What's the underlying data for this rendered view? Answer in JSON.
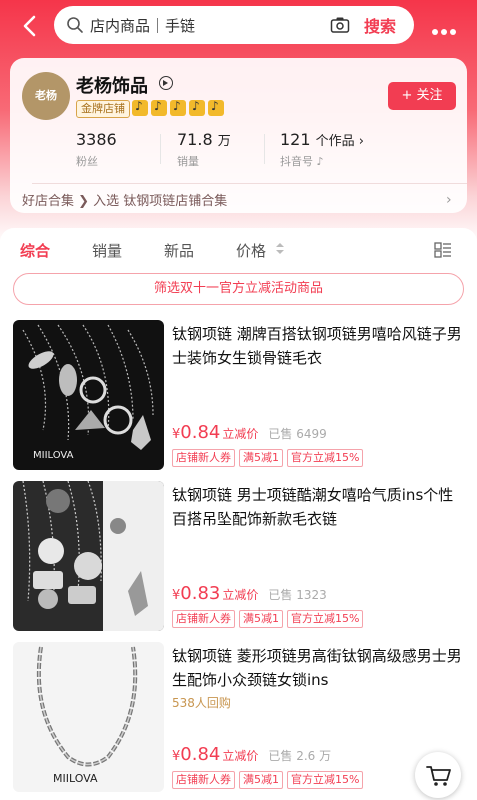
{
  "search": {
    "text": "店内商品｜手链",
    "button": "搜索"
  },
  "shop": {
    "avatar_text": "老杨",
    "name": "老杨饰品",
    "gold_badge": "金牌店铺",
    "follow": "+ 关注",
    "stats": [
      {
        "value": "3386",
        "unit": "",
        "label": "粉丝"
      },
      {
        "value": "71.8",
        "unit": "万",
        "label": "销量"
      },
      {
        "value": "121",
        "unit": "个作品 ›",
        "label": "抖音号 ♪"
      }
    ],
    "collection": "好店合集 ❯  入选 钛钢项链店铺合集",
    "collection_arrow": "›"
  },
  "tabs": {
    "items": [
      "综合",
      "销量",
      "新品",
      "价格"
    ]
  },
  "filter": "筛选双十一官方立减活动商品",
  "products": [
    {
      "title": "钛钢项链 潮牌百搭钛钢项链男嘻哈风链子男士装饰女生锁骨链毛衣",
      "extra": "",
      "price_symbol": "¥",
      "price": "0.84",
      "price_tag": "立减价",
      "sold": "已售 6499",
      "chips": [
        "店铺新人券",
        "满5减1",
        "官方立减15%"
      ],
      "brand": "MIILOVA"
    },
    {
      "title": "钛钢项链 男士项链酷潮女嘻哈气质ins个性百搭吊坠配饰新款毛衣链",
      "extra": "",
      "price_symbol": "¥",
      "price": "0.83",
      "price_tag": "立减价",
      "sold": "已售 1323",
      "chips": [
        "店铺新人券",
        "满5减1",
        "官方立减15%"
      ],
      "brand": ""
    },
    {
      "title": "钛钢项链 菱形项链男高街钛钢高级感男士男生配饰小众颈链女锁ins",
      "extra": "538人回购",
      "price_symbol": "¥",
      "price": "0.84",
      "price_tag": "立减价",
      "sold": "已售 2.6 万",
      "chips": [
        "店铺新人券",
        "满5减1",
        "官方立减15%"
      ],
      "brand": "MIILOVA"
    }
  ]
}
